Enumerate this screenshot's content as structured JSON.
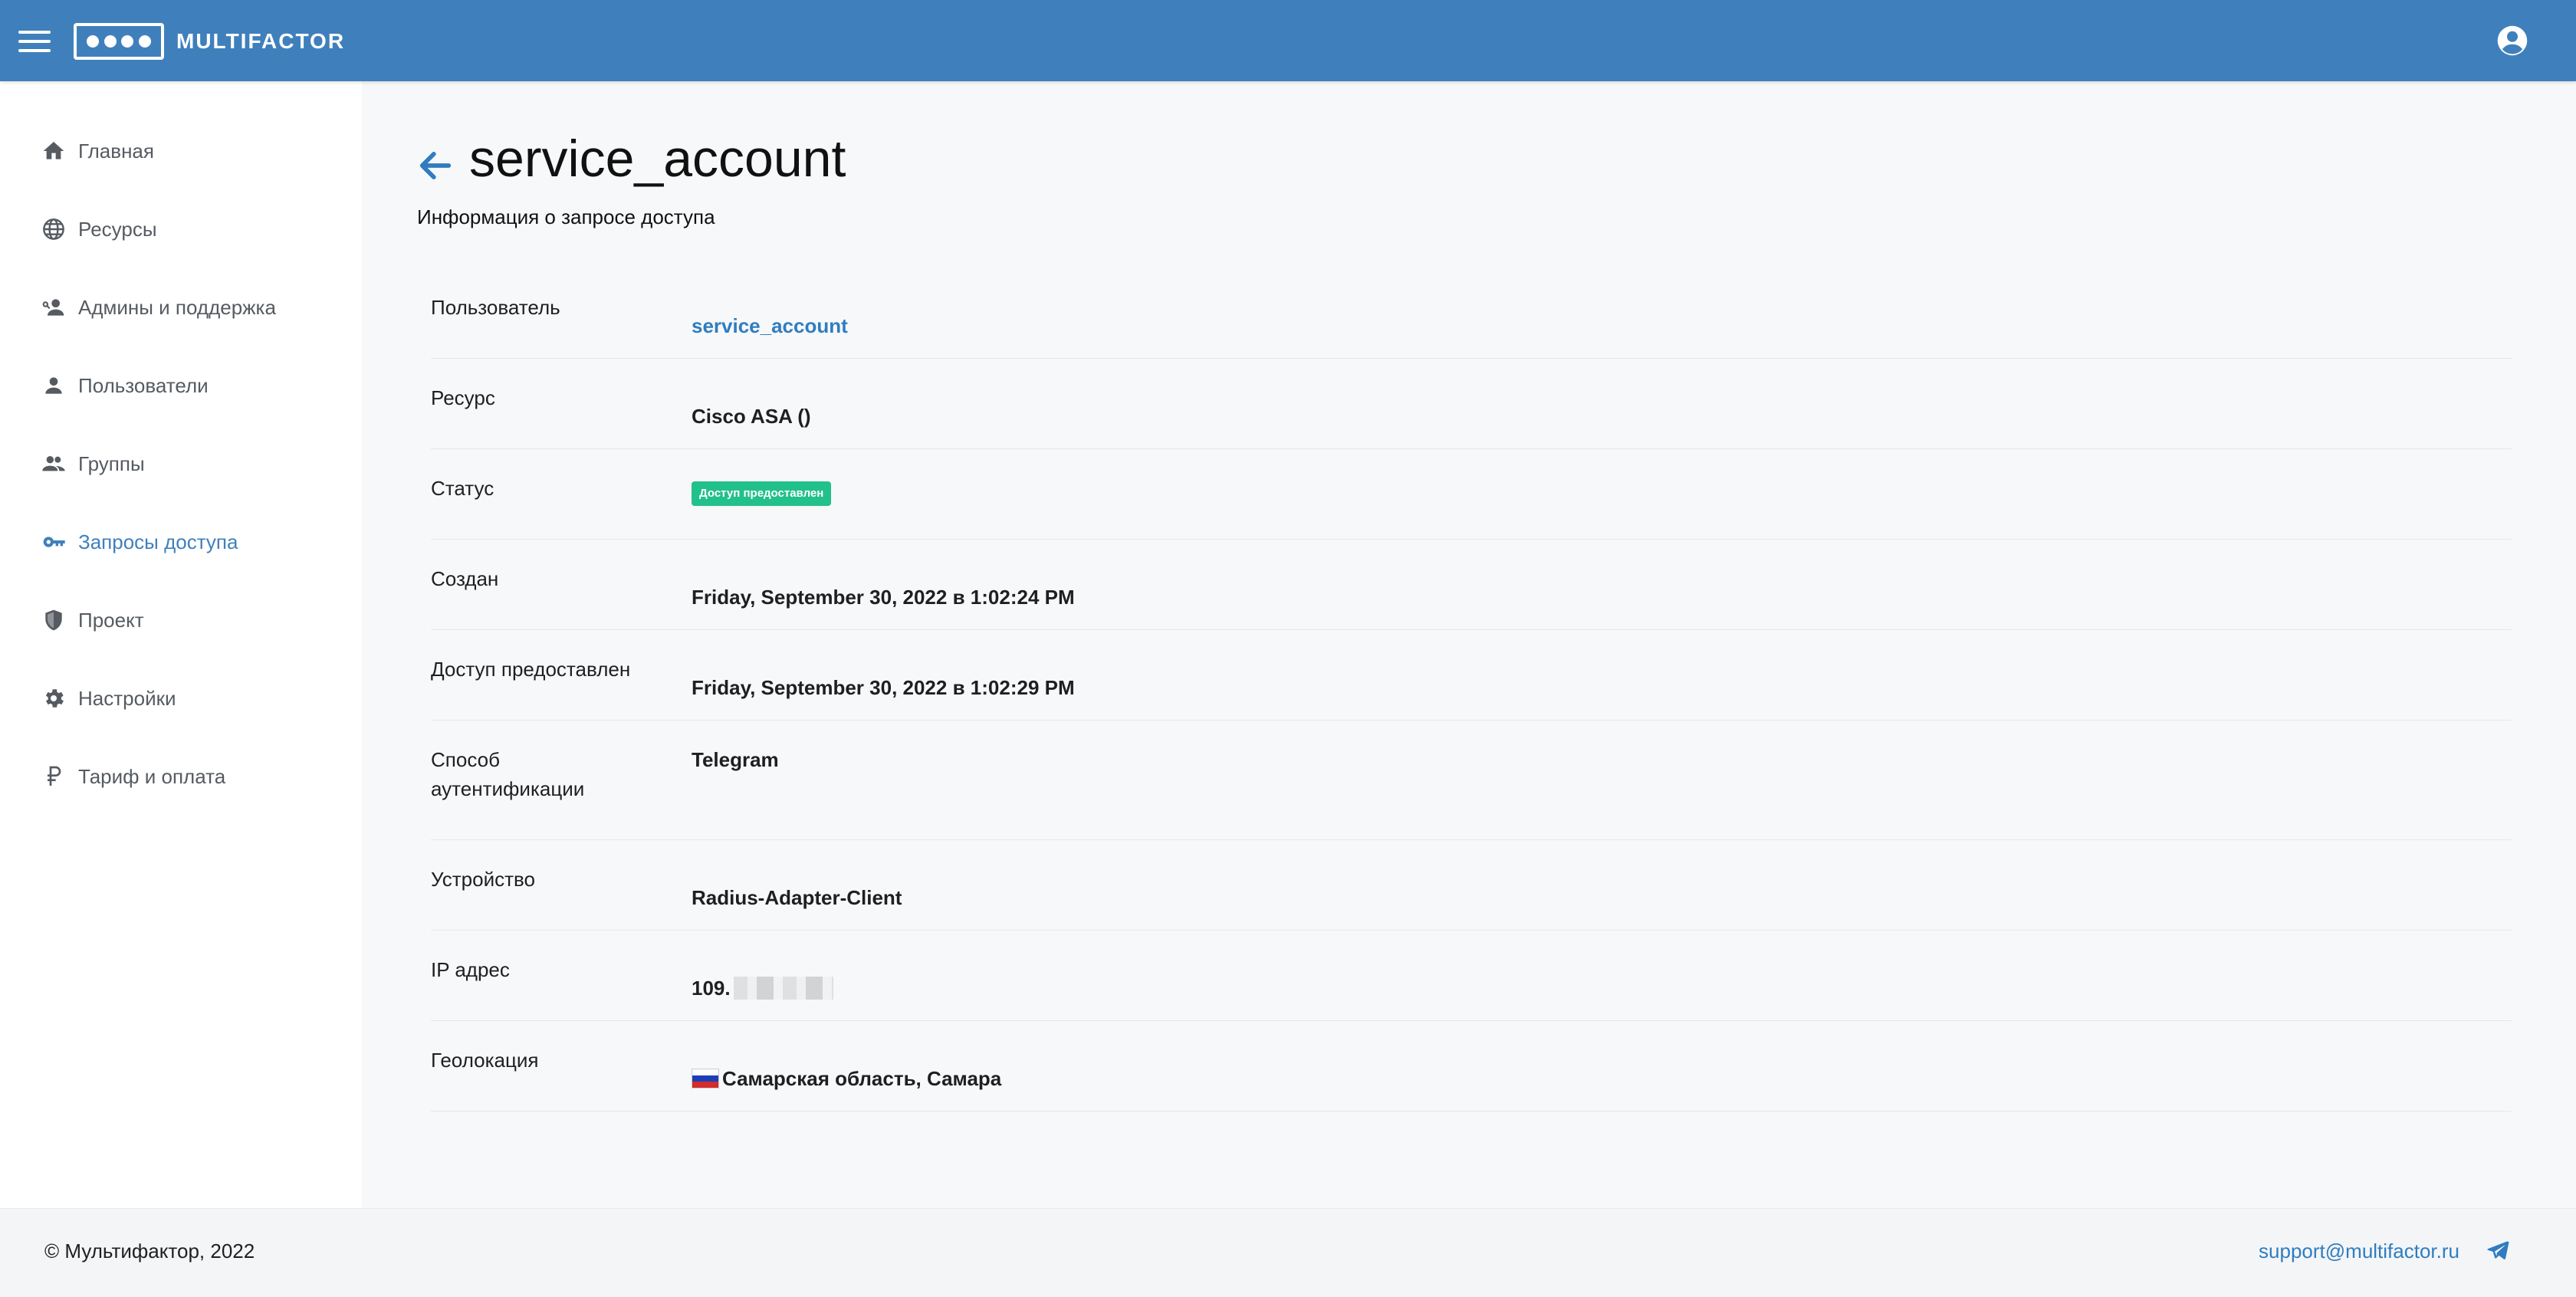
{
  "header": {
    "brand": "MULTIFACTOR",
    "menu_icon": "hamburger-icon",
    "account_icon": "account-circle-icon",
    "bg_color": "#3f80bc"
  },
  "sidebar": {
    "items": [
      {
        "label": "Главная",
        "icon": "home-icon"
      },
      {
        "label": "Ресурсы",
        "icon": "globe-icon"
      },
      {
        "label": "Админы и поддержка",
        "icon": "admin-support-icon"
      },
      {
        "label": "Пользователи",
        "icon": "user-icon"
      },
      {
        "label": "Группы",
        "icon": "group-icon"
      },
      {
        "label": "Запросы доступа",
        "icon": "key-icon",
        "active": true
      },
      {
        "label": "Проект",
        "icon": "shield-icon"
      },
      {
        "label": "Настройки",
        "icon": "gear-icon"
      },
      {
        "label": "Тариф и оплата",
        "icon": "ruble-icon"
      }
    ],
    "active_color": "#3f80bc"
  },
  "main": {
    "back_icon": "arrow-left-icon",
    "title": "service_account",
    "subtitle": "Информация о запросе доступа",
    "rows": [
      {
        "label": "Пользователь",
        "value": "service_account"
      },
      {
        "label": "Ресурс",
        "value": "Cisco ASA ()"
      },
      {
        "label": "Статус",
        "value": "Доступ предоставлен"
      },
      {
        "label": "Создан",
        "value": "Friday, September 30, 2022 в 1:02:24 PM"
      },
      {
        "label": "Доступ предоставлен",
        "value": "Friday, September 30, 2022 в 1:02:29 PM"
      },
      {
        "label": "Способ аутентификации",
        "value": "Telegram"
      },
      {
        "label": "Устройство",
        "value": "Radius-Adapter-Client"
      },
      {
        "label": "IP адрес",
        "value": "109."
      },
      {
        "label": "Геолокация",
        "value": "Самарская область, Самара"
      }
    ],
    "status_color": "#22c08a",
    "link_color": "#2f7dc0"
  },
  "footer": {
    "copyright": "© Мультифактор, 2022",
    "email": "support@multifactor.ru",
    "telegram_icon": "telegram-icon"
  }
}
